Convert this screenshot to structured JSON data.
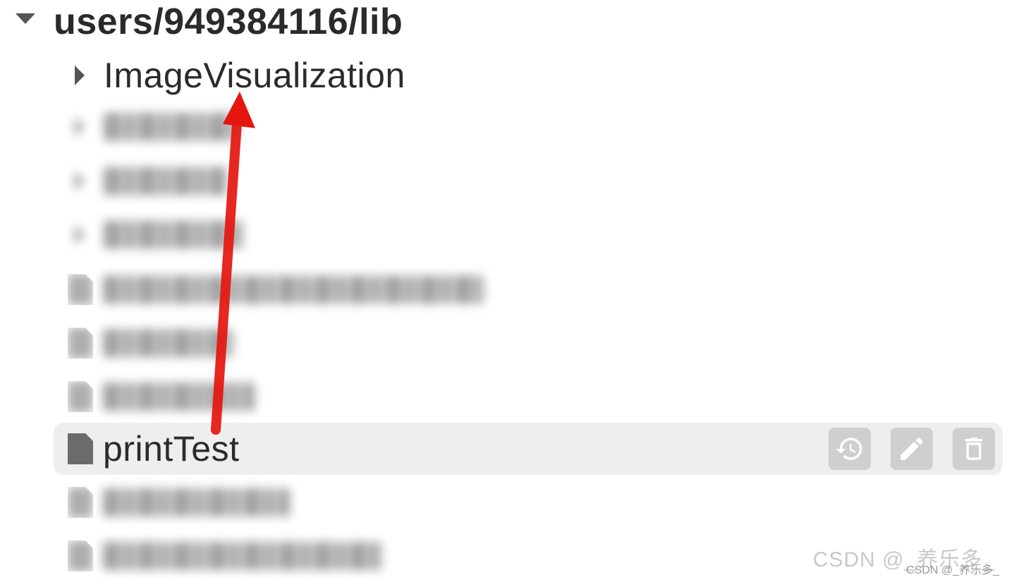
{
  "tree": {
    "root": {
      "label": "users/949384116/lib",
      "icon": "caret-down-icon"
    },
    "folders": [
      {
        "label": "ImageVisualization",
        "blurred": false
      },
      {
        "label": "",
        "blurred": true
      },
      {
        "label": "",
        "blurred": true
      },
      {
        "label": "",
        "blurred": true
      }
    ],
    "files": [
      {
        "label": "",
        "blurred": true
      },
      {
        "label": "",
        "blurred": true
      },
      {
        "label": "",
        "blurred": true
      },
      {
        "label": "printTest",
        "blurred": false,
        "selected": true
      },
      {
        "label": "",
        "blurred": true
      },
      {
        "label": "",
        "blurred": true
      }
    ],
    "selected_actions": [
      {
        "name": "history",
        "icon": "history-icon"
      },
      {
        "name": "edit",
        "icon": "pencil-icon"
      },
      {
        "name": "delete",
        "icon": "trash-icon"
      }
    ]
  },
  "annotation": {
    "arrow_color": "#e5150f"
  },
  "watermark": {
    "text": "CSDN @_养乐多_",
    "small_text": "CSDN @_养乐多_"
  }
}
